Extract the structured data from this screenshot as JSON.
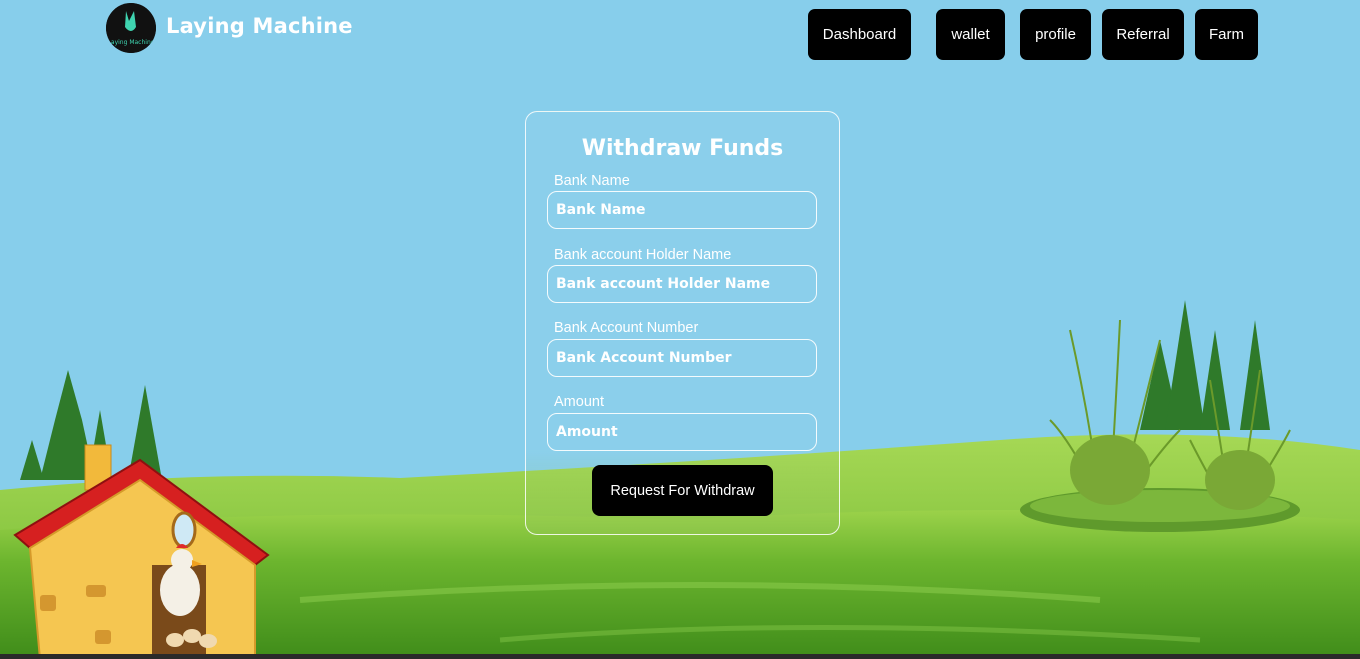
{
  "brand": {
    "name": "Laying Machine",
    "logo_text": "Laying Machine"
  },
  "nav": {
    "dashboard": "Dashboard",
    "wallet": "wallet",
    "profile": "profile",
    "referral": "Referral",
    "farm": "Farm"
  },
  "form": {
    "title": "Withdraw Funds",
    "bank_name": {
      "label": "Bank Name",
      "placeholder": "Bank Name"
    },
    "holder_name": {
      "label": "Bank account Holder Name",
      "placeholder": "Bank account Holder Name"
    },
    "account_number": {
      "label": "Bank Account Number",
      "placeholder": "Bank Account Number"
    },
    "amount": {
      "label": "Amount",
      "placeholder": "Amount"
    },
    "submit_label": "Request For Withdraw"
  },
  "colors": {
    "sky": "#87ceeb",
    "grass": "#5fa82a",
    "button_bg": "#000000",
    "button_text": "#ffffff"
  }
}
